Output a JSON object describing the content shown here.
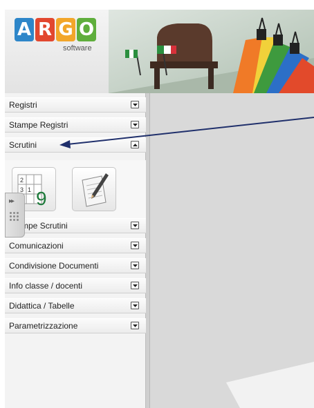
{
  "brand": {
    "letters": [
      {
        "char": "A",
        "color": "#2e86c9"
      },
      {
        "char": "R",
        "color": "#e2472f"
      },
      {
        "char": "G",
        "color": "#f2a62a"
      },
      {
        "char": "O",
        "color": "#5fae3c"
      }
    ],
    "subtitle": "software"
  },
  "menu": {
    "items": [
      {
        "label": "Registri",
        "expanded": false
      },
      {
        "label": "Stampe Registri",
        "expanded": false
      },
      {
        "label": "Scrutini",
        "expanded": true
      },
      {
        "label": "Stampe Scrutini",
        "expanded": false
      },
      {
        "label": "Comunicazioni",
        "expanded": false
      },
      {
        "label": "Condivisione Documenti",
        "expanded": false
      },
      {
        "label": "Info classe / docenti",
        "expanded": false
      },
      {
        "label": "Didattica / Tabelle",
        "expanded": false
      },
      {
        "label": "Parametrizzazione",
        "expanded": false
      }
    ]
  },
  "scrutini_tools": [
    {
      "icon": "grade-grid-icon",
      "digits": [
        "2",
        "3",
        "1",
        "9"
      ]
    },
    {
      "icon": "notepad-pencil-icon"
    }
  ],
  "handle": {
    "chevron": "▸▸"
  },
  "colors": {
    "annotation_arrow": "#1f2f6b",
    "grade_digit": "#1e7a3b"
  }
}
